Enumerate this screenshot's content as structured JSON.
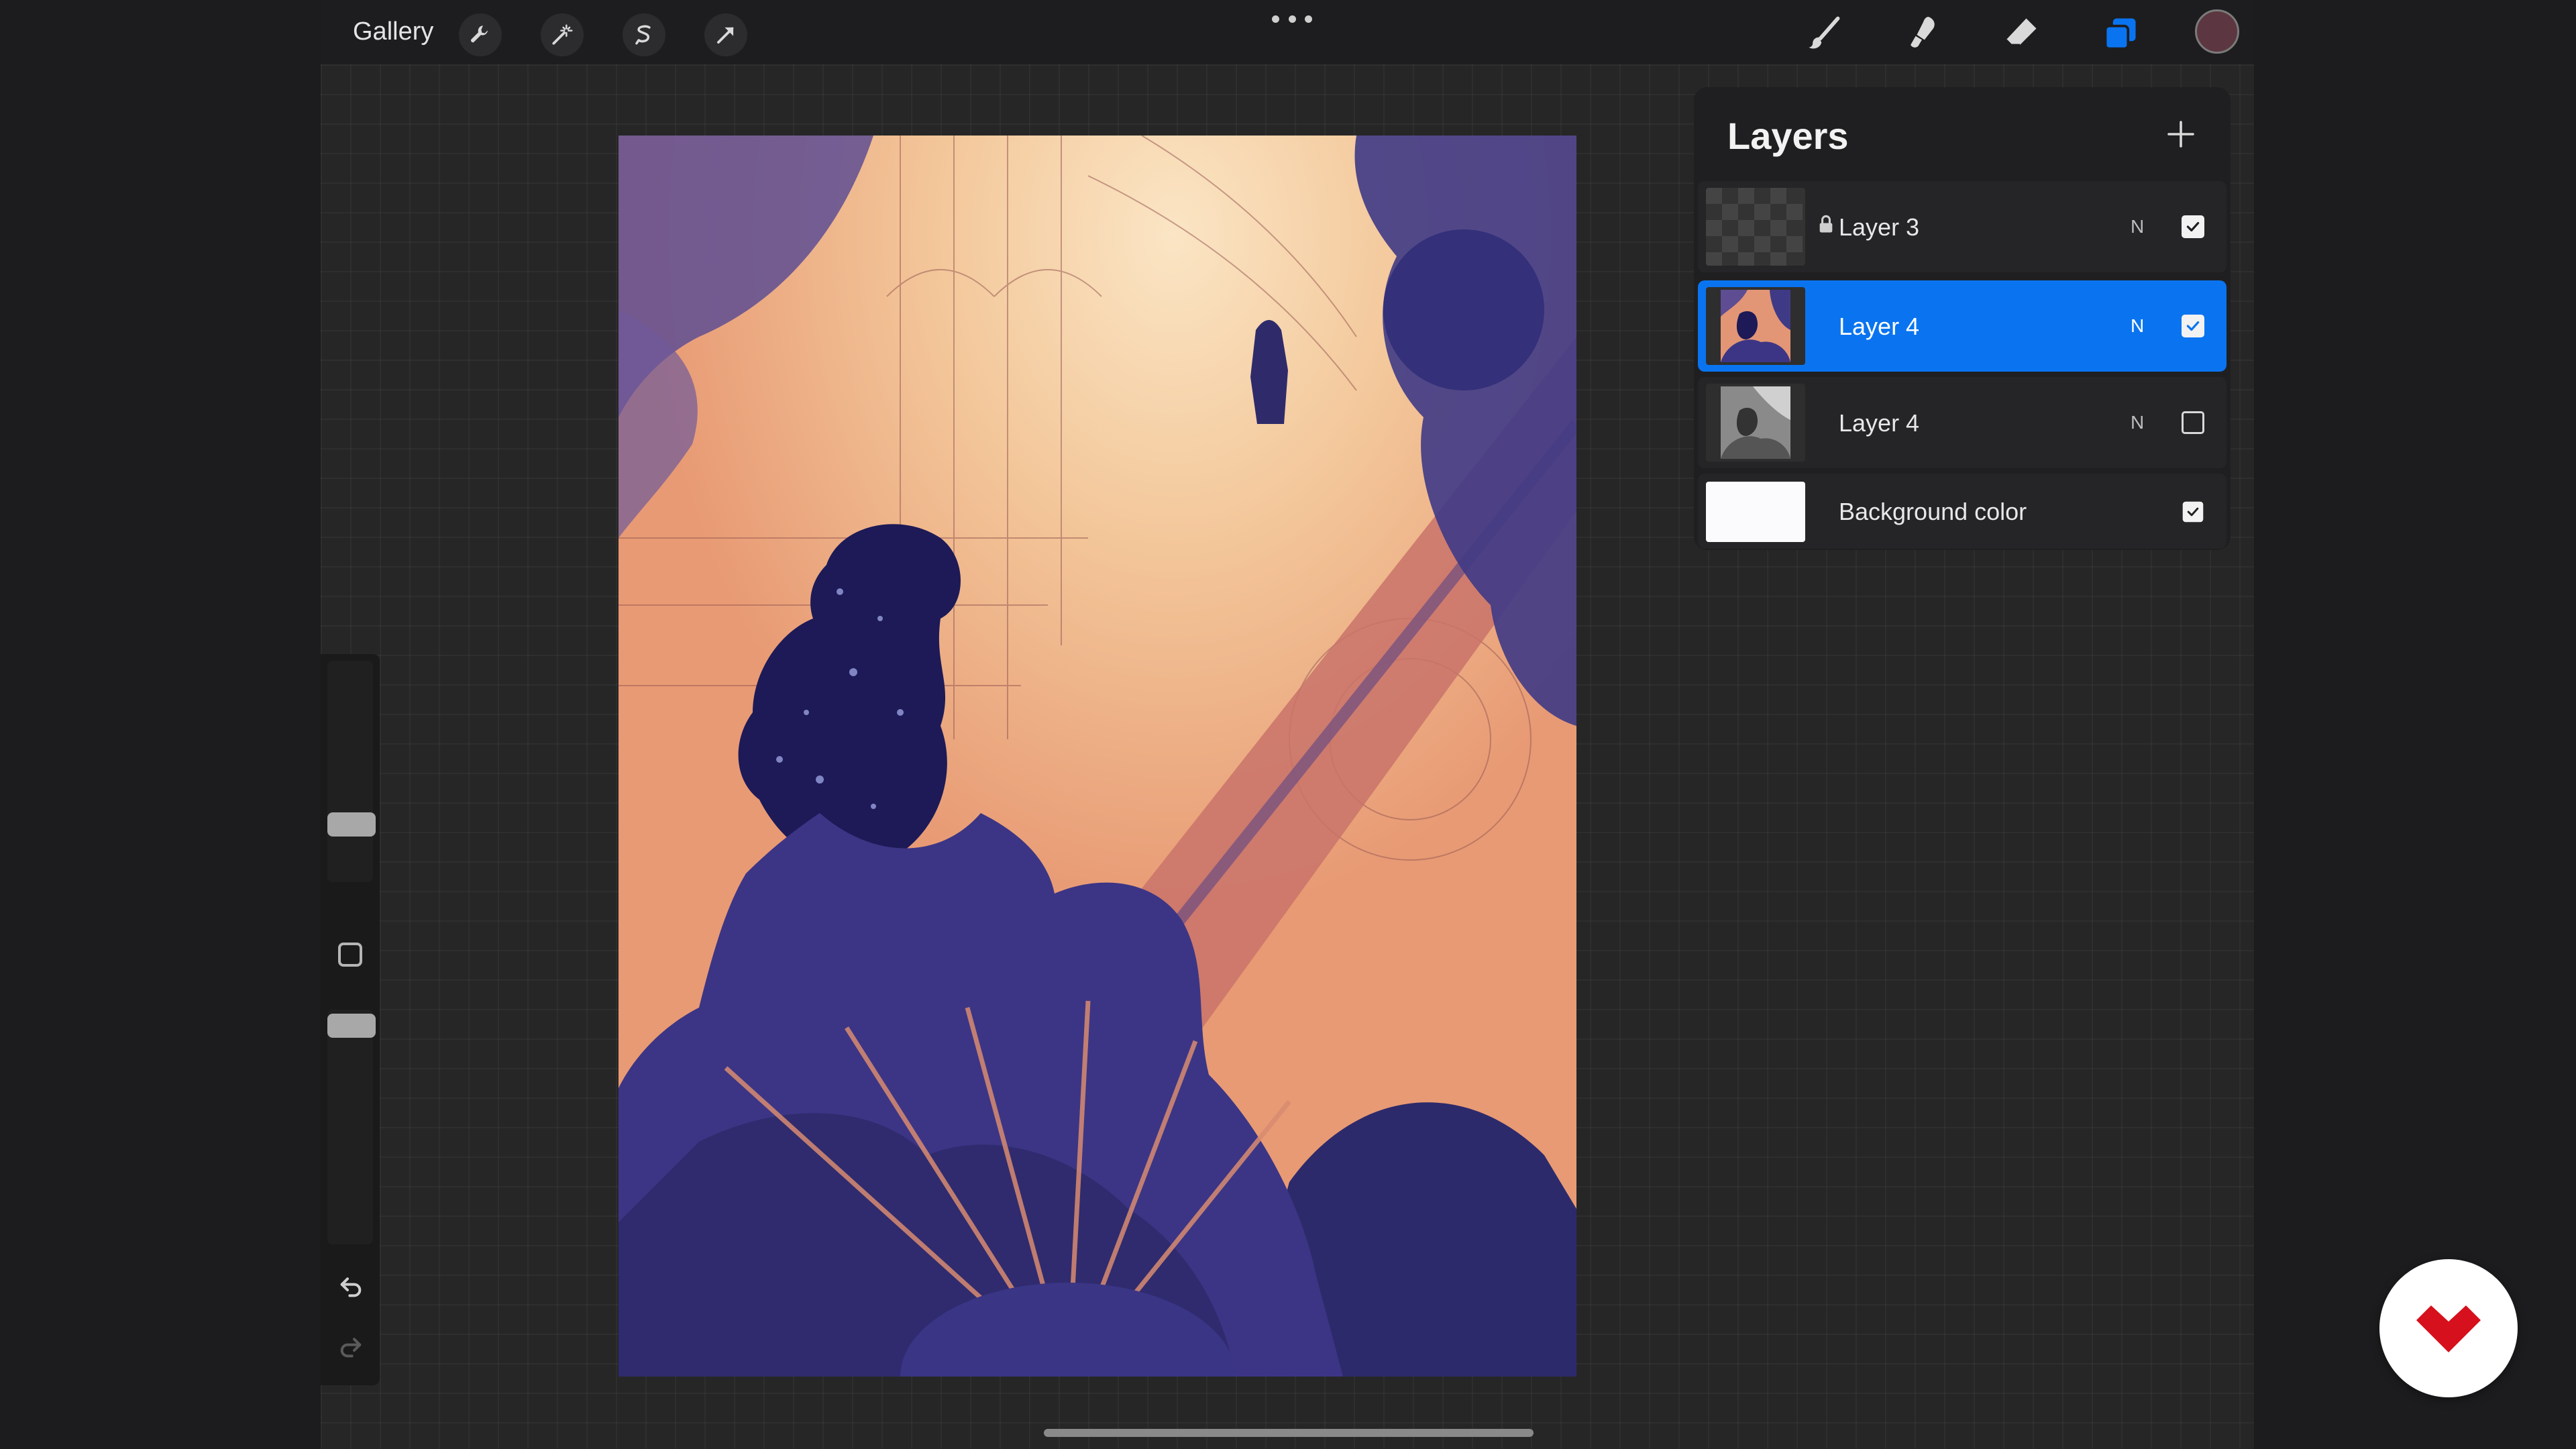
{
  "topbar": {
    "gallery_label": "Gallery",
    "left_tools": [
      "wrench-icon",
      "magic-wand-icon",
      "selection-icon",
      "transform-arrow-icon"
    ],
    "right_tools": [
      "brush-icon",
      "smudge-icon",
      "eraser-icon",
      "layers-icon"
    ],
    "current_color": "#5c3640"
  },
  "layers_panel": {
    "title": "Layers",
    "layers": [
      {
        "name": "Layer 3",
        "blend": "N",
        "visible": true,
        "locked": true,
        "selected": false
      },
      {
        "name": "Layer 4",
        "blend": "N",
        "visible": true,
        "locked": false,
        "selected": true
      },
      {
        "name": "Layer 4",
        "blend": "N",
        "visible": false,
        "locked": false,
        "selected": false
      },
      {
        "name": "Background color",
        "blend": "",
        "visible": true,
        "locked": false,
        "selected": false
      }
    ]
  },
  "colors": {
    "accent": "#0a74f0",
    "artwork_navy": "#2d2a6b",
    "artwork_salmon": "#e89a74",
    "artwork_cream": "#f7dcb8",
    "brand_red": "#d6101c"
  }
}
